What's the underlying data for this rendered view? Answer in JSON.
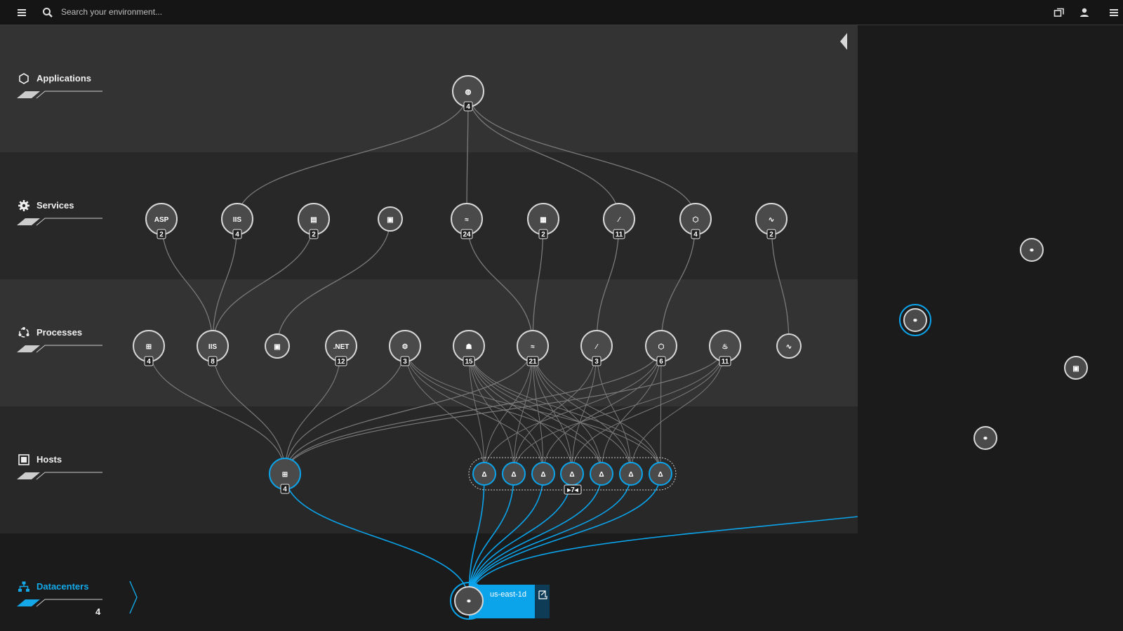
{
  "topbar": {
    "search_placeholder": "Search your environment..."
  },
  "layers": [
    {
      "key": "applications",
      "label": "Applications"
    },
    {
      "key": "services",
      "label": "Services"
    },
    {
      "key": "processes",
      "label": "Processes"
    },
    {
      "key": "hosts",
      "label": "Hosts"
    },
    {
      "key": "datacenters",
      "label": "Datacenters",
      "count": "4"
    }
  ],
  "graph": {
    "applications": [
      {
        "icon": "globe-icon",
        "glyph": "◍",
        "count": "4"
      }
    ],
    "services": [
      {
        "icon": "aspnet-icon",
        "glyph": "ASP",
        "count": "2"
      },
      {
        "icon": "iis-icon",
        "glyph": "IIS",
        "count": "4"
      },
      {
        "icon": "database-icon",
        "glyph": "▤",
        "count": "2"
      },
      {
        "icon": "container-icon",
        "glyph": "▣",
        "count": ""
      },
      {
        "icon": "apache-icon",
        "glyph": "≈",
        "count": "24"
      },
      {
        "icon": "queue-icon",
        "glyph": "▦",
        "count": "2"
      },
      {
        "icon": "feather-icon",
        "glyph": "⁄",
        "count": "11"
      },
      {
        "icon": "nodejs-icon",
        "glyph": "⬡",
        "count": "4"
      },
      {
        "icon": "mysql-icon",
        "glyph": "∿",
        "count": "2"
      }
    ],
    "processes": [
      {
        "icon": "windows-icon",
        "glyph": "⊞",
        "count": "4"
      },
      {
        "icon": "iis-icon",
        "glyph": "IIS",
        "count": "8"
      },
      {
        "icon": "container-icon",
        "glyph": "▣",
        "count": ""
      },
      {
        "icon": "dotnet-icon",
        "glyph": ".NET",
        "count": "12"
      },
      {
        "icon": "cog-process-icon",
        "glyph": "⚙",
        "count": "3"
      },
      {
        "icon": "tomcat-icon",
        "glyph": "☗",
        "count": "15"
      },
      {
        "icon": "apache-icon",
        "glyph": "≈",
        "count": "21"
      },
      {
        "icon": "feather-icon",
        "glyph": "⁄",
        "count": "3"
      },
      {
        "icon": "nodejs-icon",
        "glyph": "⬡",
        "count": "6"
      },
      {
        "icon": "java-icon",
        "glyph": "♨",
        "count": "11"
      },
      {
        "icon": "mysql-icon",
        "glyph": "∿",
        "count": ""
      }
    ],
    "hosts": {
      "windows": {
        "icon": "windows-icon",
        "glyph": "⊞",
        "count": "4"
      },
      "linux": [
        {
          "icon": "linux-icon",
          "glyph": "Δ"
        },
        {
          "icon": "linux-icon",
          "glyph": "Δ"
        },
        {
          "icon": "linux-icon",
          "glyph": "Δ"
        },
        {
          "icon": "linux-icon",
          "glyph": "Δ"
        },
        {
          "icon": "linux-icon",
          "glyph": "Δ"
        },
        {
          "icon": "linux-icon",
          "glyph": "Δ"
        },
        {
          "icon": "linux-icon",
          "glyph": "Δ"
        }
      ],
      "group_count": "7"
    },
    "datacenter": {
      "name": "us-east-1d",
      "icon": "datacenter-icon"
    },
    "other_datacenters": [
      {
        "icon": "datacenter-icon",
        "selected": false
      },
      {
        "icon": "datacenter-icon",
        "selected": true
      },
      {
        "icon": "host-icon",
        "selected": false
      },
      {
        "icon": "datacenter-icon",
        "selected": false
      }
    ]
  },
  "colors": {
    "accent": "#0ba3ea",
    "edge": "#7a7a7a",
    "node_fill": "#4a4a4a",
    "node_stroke": "#d8d8d8"
  }
}
